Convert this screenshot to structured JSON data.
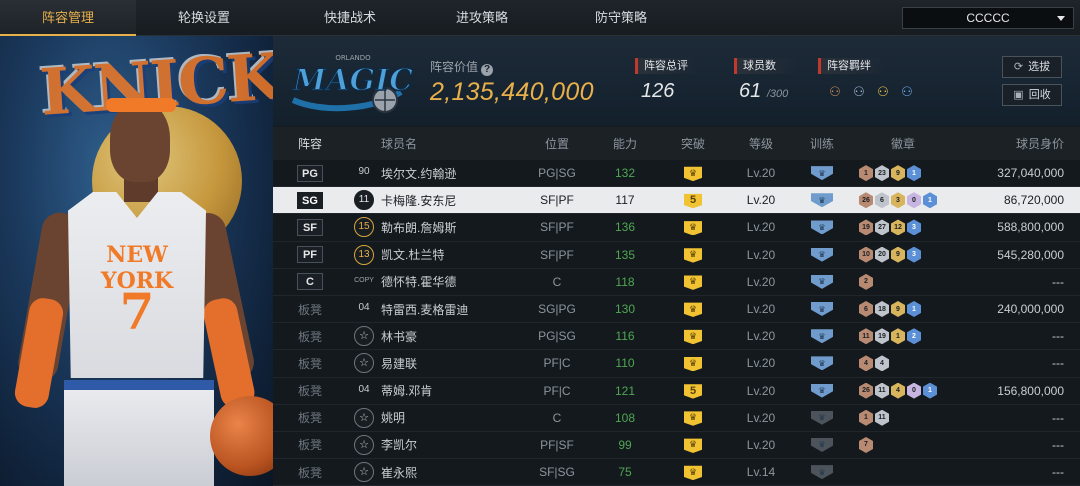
{
  "nav": {
    "tabs": [
      {
        "label": "阵容管理",
        "active": true
      },
      {
        "label": "轮换设置"
      },
      {
        "label": "快捷战术"
      },
      {
        "label": "进攻策略"
      },
      {
        "label": "防守策略"
      }
    ],
    "team_select": "CCCCC"
  },
  "player_art": {
    "logo_text": "KNICKS",
    "jersey_text": "NEW YORK",
    "jersey_number": "7"
  },
  "team": {
    "logo_text": "MAGIC",
    "logo_subtext": "ORLANDO",
    "value_label": "阵容价值",
    "value": "2,135,440,000",
    "stats": [
      {
        "label": "阵容总评",
        "value": "126",
        "suffix": ""
      },
      {
        "label": "球员数",
        "value": "61",
        "suffix": "/300"
      },
      {
        "label": "阵容羁绊",
        "value": "",
        "suffix": ""
      }
    ],
    "bond_colors": [
      "#c98c5a",
      "#9fb6d8",
      "#e8c04a",
      "#6aa8e8"
    ],
    "buttons": {
      "select": "选拔",
      "recycle": "回收"
    }
  },
  "table": {
    "headers": {
      "pos": "阵容",
      "name": "球员名",
      "position": "位置",
      "rating": "能力",
      "breakthrough": "突破",
      "level": "等级",
      "training": "训练",
      "badges": "徽章",
      "value": "球员身价"
    },
    "rows": [
      {
        "slot": "PG",
        "bench": false,
        "num": "90",
        "num_style": "plain",
        "name": "埃尔文.约翰逊",
        "position": "PG|SG",
        "rating": "132",
        "rating_green": true,
        "break": "crown",
        "level": "Lv.20",
        "train": "blue",
        "badges": [
          [
            "1",
            "bronze"
          ],
          [
            "23",
            "silver"
          ],
          [
            "9",
            "gold"
          ],
          [
            "1",
            "blue"
          ]
        ],
        "value": "327,040,000",
        "selected": false
      },
      {
        "slot": "SG",
        "bench": false,
        "num": "11",
        "num_style": "dark",
        "name": "卡梅隆.安东尼",
        "position": "SF|PF",
        "rating": "117",
        "rating_green": false,
        "break": "5",
        "level": "Lv.20",
        "train": "blue",
        "badges": [
          [
            "26",
            "bronze"
          ],
          [
            "6",
            "silver"
          ],
          [
            "3",
            "gold"
          ],
          [
            "0",
            "purple"
          ],
          [
            "1",
            "blue"
          ]
        ],
        "value": "86,720,000",
        "selected": true
      },
      {
        "slot": "SF",
        "bench": false,
        "num": "15",
        "num_style": "gold",
        "name": "勒布朗.詹姆斯",
        "position": "SF|PF",
        "rating": "136",
        "rating_green": true,
        "break": "crown",
        "level": "Lv.20",
        "train": "blue",
        "badges": [
          [
            "19",
            "bronze"
          ],
          [
            "27",
            "silver"
          ],
          [
            "12",
            "gold"
          ],
          [
            "3",
            "blue"
          ]
        ],
        "value": "588,800,000",
        "selected": false
      },
      {
        "slot": "PF",
        "bench": false,
        "num": "13",
        "num_style": "gold",
        "name": "凯文.杜兰特",
        "position": "SF|PF",
        "rating": "135",
        "rating_green": true,
        "break": "crown",
        "level": "Lv.20",
        "train": "blue",
        "badges": [
          [
            "10",
            "bronze"
          ],
          [
            "20",
            "silver"
          ],
          [
            "9",
            "gold"
          ],
          [
            "3",
            "blue"
          ]
        ],
        "value": "545,280,000",
        "selected": false
      },
      {
        "slot": "C",
        "bench": false,
        "num": "COPY",
        "num_style": "copy",
        "name": "德怀特.霍华德",
        "position": "C",
        "rating": "118",
        "rating_green": true,
        "break": "crown",
        "level": "Lv.20",
        "train": "blue",
        "badges": [
          [
            "2",
            "bronze"
          ]
        ],
        "value": "---",
        "selected": false
      },
      {
        "slot": "板凳",
        "bench": true,
        "num": "04",
        "num_style": "plain",
        "name": "特雷西.麦格雷迪",
        "position": "SG|PG",
        "rating": "130",
        "rating_green": true,
        "break": "crown",
        "level": "Lv.20",
        "train": "blue",
        "badges": [
          [
            "6",
            "bronze"
          ],
          [
            "18",
            "silver"
          ],
          [
            "9",
            "gold"
          ],
          [
            "1",
            "blue"
          ]
        ],
        "value": "240,000,000",
        "selected": false
      },
      {
        "slot": "板凳",
        "bench": true,
        "num": "☆",
        "num_style": "star",
        "name": "林书豪",
        "position": "PG|SG",
        "rating": "116",
        "rating_green": true,
        "break": "crown",
        "level": "Lv.20",
        "train": "blue",
        "badges": [
          [
            "11",
            "bronze"
          ],
          [
            "19",
            "silver"
          ],
          [
            "1",
            "gold"
          ],
          [
            "2",
            "blue"
          ]
        ],
        "value": "---",
        "selected": false
      },
      {
        "slot": "板凳",
        "bench": true,
        "num": "☆",
        "num_style": "star",
        "name": "易建联",
        "position": "PF|C",
        "rating": "110",
        "rating_green": true,
        "break": "crown",
        "level": "Lv.20",
        "train": "blue",
        "badges": [
          [
            "4",
            "bronze"
          ],
          [
            "4",
            "silver"
          ]
        ],
        "value": "---",
        "selected": false
      },
      {
        "slot": "板凳",
        "bench": true,
        "num": "04",
        "num_style": "plain",
        "name": "蒂姆.邓肯",
        "position": "PF|C",
        "rating": "121",
        "rating_green": true,
        "break": "5",
        "level": "Lv.20",
        "train": "blue",
        "badges": [
          [
            "26",
            "bronze"
          ],
          [
            "11",
            "silver"
          ],
          [
            "4",
            "gold"
          ],
          [
            "0",
            "purple"
          ],
          [
            "1",
            "blue"
          ]
        ],
        "value": "156,800,000",
        "selected": false
      },
      {
        "slot": "板凳",
        "bench": true,
        "num": "☆",
        "num_style": "star",
        "name": "姚明",
        "position": "C",
        "rating": "108",
        "rating_green": true,
        "break": "crown",
        "level": "Lv.20",
        "train": "gray",
        "badges": [
          [
            "1",
            "bronze"
          ],
          [
            "11",
            "silver"
          ]
        ],
        "value": "---",
        "selected": false
      },
      {
        "slot": "板凳",
        "bench": true,
        "num": "☆",
        "num_style": "star",
        "name": "李凯尔",
        "position": "PF|SF",
        "rating": "99",
        "rating_green": true,
        "break": "crown",
        "level": "Lv.20",
        "train": "gray",
        "badges": [
          [
            "7",
            "bronze"
          ]
        ],
        "value": "---",
        "selected": false
      },
      {
        "slot": "板凳",
        "bench": true,
        "num": "☆",
        "num_style": "star",
        "name": "崔永熙",
        "position": "SF|SG",
        "rating": "75",
        "rating_green": true,
        "break": "crown",
        "level": "Lv.14",
        "train": "gray",
        "badges": [],
        "value": "---",
        "selected": false
      }
    ]
  }
}
